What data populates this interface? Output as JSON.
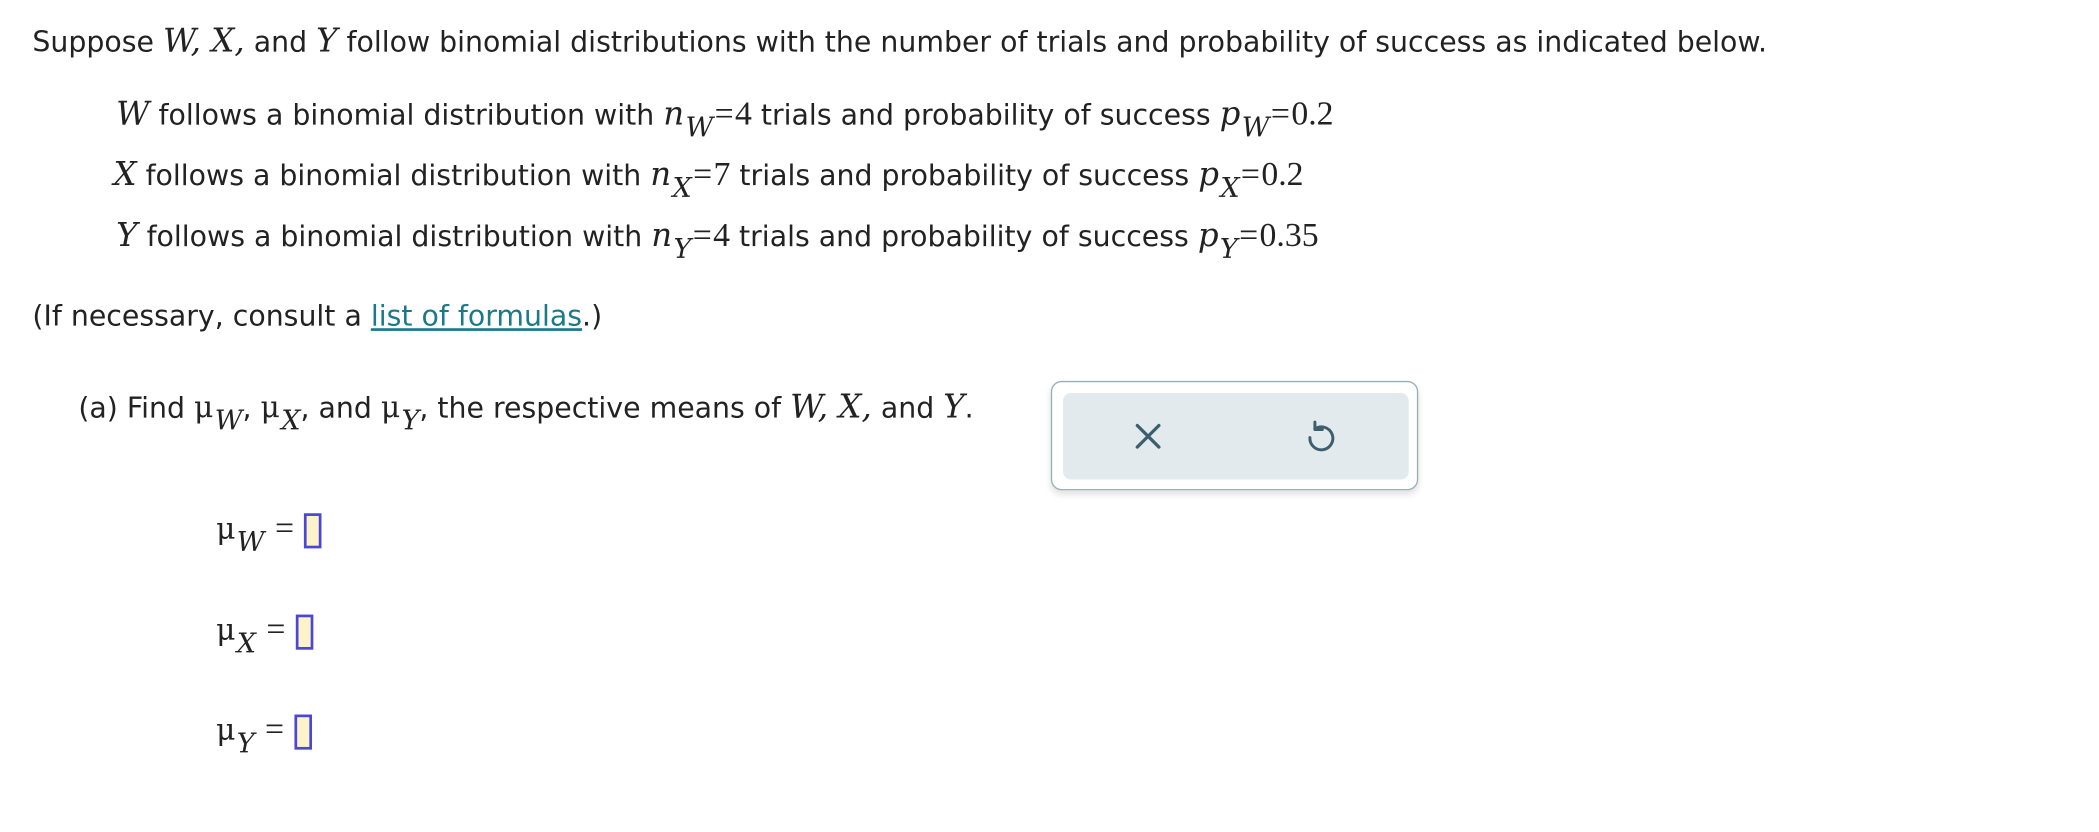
{
  "intro": {
    "prefix": "Suppose",
    "vars": "W, X,",
    "and": " and ",
    "y": "Y",
    "suffix": " follow binomial distributions with the number of trials and probability of success as indicated below."
  },
  "distributions": [
    {
      "var": "W",
      "text1": " follows a binomial distribution with ",
      "n_sym": "n",
      "sub": "W",
      "n_value": "4",
      "text2": " trials and probability of success ",
      "p_sym": "p",
      "p_value": "0.2"
    },
    {
      "var": "X",
      "text1": " follows a binomial distribution with ",
      "n_sym": "n",
      "sub": "X",
      "n_value": "7",
      "text2": " trials and probability of success ",
      "p_sym": "p",
      "p_value": "0.2"
    },
    {
      "var": "Y",
      "text1": " follows a binomial distribution with ",
      "n_sym": "n",
      "sub": "Y",
      "n_value": "4",
      "text2": " trials and probability of success ",
      "p_sym": "p",
      "p_value": "0.35"
    }
  ],
  "consult": {
    "prefix": "(If necessary, consult a ",
    "link": "list of formulas",
    "suffix": ".)"
  },
  "question": {
    "label": "(a) Find ",
    "mu": "μ",
    "subs": [
      "W",
      "X",
      "Y"
    ],
    "sep1": ", ",
    "sep2": ", and ",
    "text": ", the respective means of ",
    "vars": "W, X,",
    "and": " and ",
    "last_var": "Y",
    "end": "."
  },
  "answers": [
    {
      "mu": "μ",
      "sub": "W",
      "eq": "=",
      "value": ""
    },
    {
      "mu": "μ",
      "sub": "X",
      "eq": "=",
      "value": ""
    },
    {
      "mu": "μ",
      "sub": "Y",
      "eq": "=",
      "value": ""
    }
  ],
  "panel": {
    "clear_icon": "close-icon",
    "reset_icon": "undo-icon",
    "icon_color": "#3d5f6d"
  }
}
